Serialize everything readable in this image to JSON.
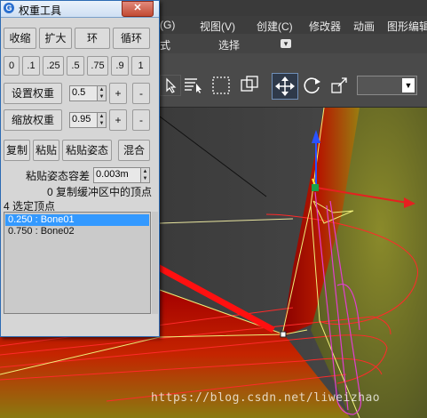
{
  "dialog": {
    "title": "权重工具",
    "close": "✕",
    "buttons_row1": [
      "收缩",
      "扩大",
      "环",
      "循环"
    ],
    "preset_weights": [
      "0",
      ".1",
      ".25",
      ".5",
      ".75",
      ".9",
      "1"
    ],
    "set_weight_label": "设置权重",
    "set_weight_value": "0.5",
    "scale_weight_label": "缩放权重",
    "scale_weight_value": "0.95",
    "plus": "+",
    "minus": "-",
    "copy_label": "复制",
    "paste_label": "粘贴",
    "paste_pos_label": "粘贴姿态",
    "blend_label": "混合",
    "paste_tolerance_label": "粘贴姿态容差",
    "paste_tolerance_value": "0.003m",
    "copy_buffer_status": "0 复制缓冲区中的顶点",
    "selected_vertices_status": "4 选定顶点",
    "vertex_weights": [
      {
        "text": "0.250 : Bone01",
        "selected": true
      },
      {
        "text": "0.750 : Bone02",
        "selected": false
      }
    ]
  },
  "menubar": {
    "items": [
      "(G)",
      "视图(V)",
      "创建(C)",
      "修改器",
      "动画",
      "图形编辑"
    ]
  },
  "ribbon": {
    "left_text": "式",
    "selection": "选择",
    "dropdown_glyph": "▾"
  },
  "toolbar": {
    "viewport_bracket": "]"
  },
  "watermark": "https://blog.csdn.net/liweizhao"
}
